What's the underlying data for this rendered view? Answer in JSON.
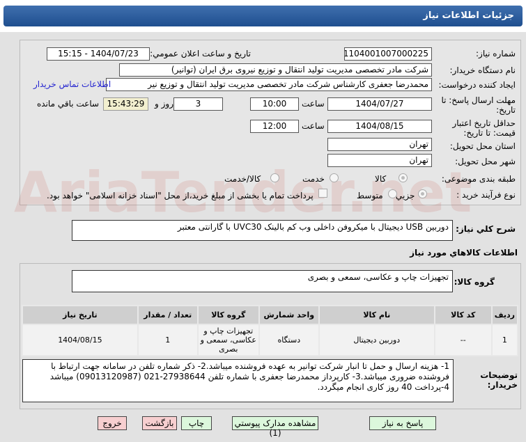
{
  "header": {
    "title": "جزئيات اطلاعات نياز"
  },
  "form": {
    "need_number_label": "شماره نياز:",
    "need_number": "1104001007000225",
    "announce_label": "تاريخ و ساعت اعلان عمومي:",
    "announce_value": "1404/07/23 - 15:15",
    "buyer_label": "نام دستگاه خريدار:",
    "buyer_value": "شرکت مادر تخصصی مدیریت تولید  انتقال و توزیع نیروی برق ایران (توانیر)",
    "creator_label": "ايجاد کننده درخواست:",
    "creator_value": "محمدرضا جعفری کارشناس شرکت مادر تخصصی مدیریت تولید  انتقال و توزیع نیر",
    "contact_link": "اطلاعات تماس خريدار",
    "deadline_label": "مهلت ارسال پاسخ: تا تاريخ:",
    "deadline_date": "1404/07/27",
    "hour_label": "ساعت",
    "deadline_time": "10:00",
    "days": "3",
    "days_label": "روز و",
    "remaining": "15:43:29",
    "remaining_label": "ساعت باقي مانده",
    "validity_label": "حداقل تاريخ اعتبار قيمت: تا تاريخ:",
    "validity_date": "1404/08/15",
    "validity_time": "12:00",
    "province_label": "استان محل تحويل:",
    "province": "تهران",
    "city_label": "شهر محل تحويل:",
    "city": "تهران",
    "category_label": "طبقه بندی موضوعی:",
    "category_options": [
      "کالا",
      "خدمت",
      "کالا/خدمت"
    ],
    "category_selected": "کالا",
    "process_label": "نوع فرآيند خريد :",
    "process_options": [
      "جزيي",
      "متوسط"
    ],
    "process_selected": "جزيي",
    "payment_note": "پرداخت تمام يا بخشی از مبلغ خريد،از محل \"اسناد خزانه اسلامی\" خواهد بود."
  },
  "summary": {
    "label": "شرح کلي نياز:",
    "value": "دوربین USB دیجیتال با میکروفن داخلی وب کم بالینک UVC30 با گارانتی معتبر"
  },
  "goods": {
    "title": "اطلاعات کالاهاي مورد نياز",
    "group_label": "گروه کالا:",
    "group_value": "تجهیزات چاپ و عکاسی، سمعی و بصری",
    "columns": [
      "رديف",
      "کد کالا",
      "نام کالا",
      "واحد شمارش",
      "گروه کالا",
      "تعداد / مقدار",
      "تاريخ نياز"
    ],
    "rows": [
      [
        "1",
        "--",
        "دوربین دیجیتال",
        "دستگاه",
        "تجهیزات چاپ و عکاسی، سمعی و بصری",
        "1",
        "1404/08/15"
      ]
    ]
  },
  "notes": {
    "label": "توضيحات خريدار:",
    "lines": [
      "1- هزینه ارسال و حمل تا انبار شرکت توانیر به عهده فروشنده میباشد.2- ذکر شماره تلفن در سامانه جهت ارتباط با فروشنده ضروری میباشد.3- کارپرداز محمدرضا جعفری با شماره تلفن 27938644-021  (09013120987) میباشد",
      "4-پرداخت 40 روز کاری انجام میگردد."
    ]
  },
  "buttons": {
    "reply": "پاسخ به نياز",
    "attachments": "مشاهده مدارک پيوستي (1)",
    "print": "چاپ",
    "back": "بازگشت",
    "exit": "خروج"
  },
  "watermark": "AriaTender.net"
}
